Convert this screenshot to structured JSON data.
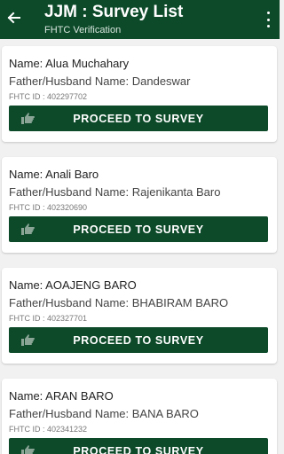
{
  "app_bar": {
    "title": "JJM : Survey List",
    "subtitle": "FHTC Verification"
  },
  "icons": {
    "back": "back-arrow-icon",
    "more": "more-vertical-icon",
    "proceed": "hand-pointer-icon"
  },
  "colors": {
    "primary": "#0d4a2a",
    "background": "#f1f1f1"
  },
  "records": [
    {
      "name": "Name: Alua Muchahary",
      "father": "Father/Husband Name: Dandeswar",
      "fhtc": "FHTC ID : 402297702",
      "button": "PROCEED TO SURVEY"
    },
    {
      "name": "Name: Anali Baro",
      "father": "Father/Husband Name: Rajenikanta Baro",
      "fhtc": "FHTC ID : 402320690",
      "button": "PROCEED TO SURVEY"
    },
    {
      "name": "Name: AOAJENG BARO",
      "father": "Father/Husband Name: BHABIRAM BARO",
      "fhtc": "FHTC ID : 402327701",
      "button": "PROCEED TO SURVEY"
    },
    {
      "name": "Name: ARAN BARO",
      "father": "Father/Husband Name: BANA BARO",
      "fhtc": "FHTC ID : 402341232",
      "button": "PROCEED TO SURVEY"
    }
  ]
}
